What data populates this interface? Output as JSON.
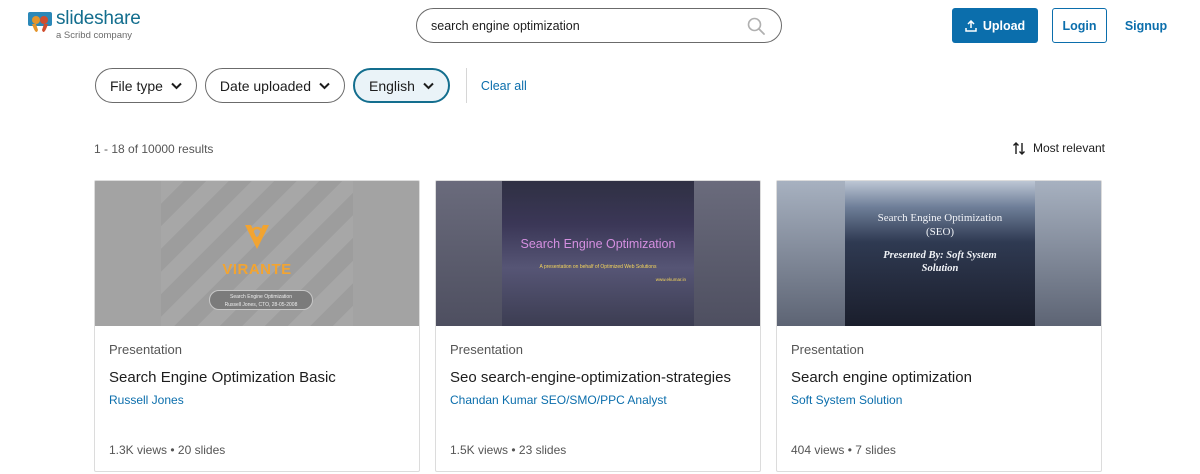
{
  "brand": {
    "name": "slideshare",
    "tagline": "a Scribd company"
  },
  "search": {
    "value": "search engine optimization",
    "placeholder": "Search"
  },
  "header": {
    "upload_label": "Upload",
    "login_label": "Login",
    "signup_label": "Signup"
  },
  "filters": {
    "items": [
      {
        "label": "File type",
        "active": false
      },
      {
        "label": "Date uploaded",
        "active": false
      },
      {
        "label": "English",
        "active": true
      }
    ],
    "clear_label": "Clear all"
  },
  "results": {
    "count_text": "1 - 18 of 10000 results",
    "sort_label": "Most relevant"
  },
  "cards": [
    {
      "type": "Presentation",
      "title": "Search Engine Optimization Basic",
      "author": "Russell Jones",
      "meta": "1.3K views • 20 slides",
      "thumb": {
        "brand": "VIRANTE",
        "pill_line1": "Search Engine Optimization",
        "pill_line2": "Russell Jones, CTO, 28-05-2008"
      }
    },
    {
      "type": "Presentation",
      "title": "Seo search-engine-optimization-strategies",
      "author": "Chandan Kumar SEO/SMO/PPC Analyst",
      "meta": "1.5K views • 23 slides",
      "thumb": {
        "title": "Search Engine Optimization",
        "subtitle": "A presentation on behalf of Optimized Web Solutions",
        "url": "www.ekumar.in"
      }
    },
    {
      "type": "Presentation",
      "title": "Search engine optimization",
      "author": "Soft System Solution",
      "meta": "404 views • 7 slides",
      "thumb": {
        "title": "Search Engine Optimization (SEO)",
        "subtitle": "Presented By: Soft System Solution"
      }
    }
  ],
  "colors": {
    "accent": "#0b6eac",
    "brand": "#136e8e",
    "active_chip_border": "#136e8e"
  }
}
